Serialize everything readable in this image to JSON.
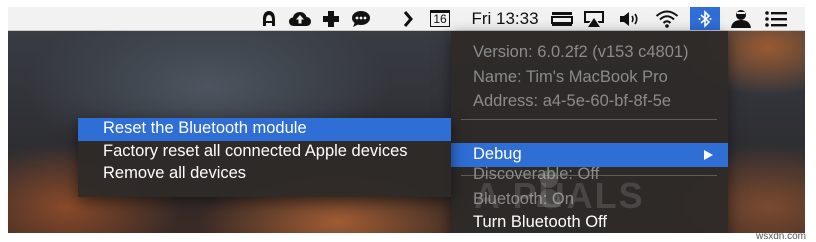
{
  "menubar": {
    "clock": "Fri 13:33",
    "calendar_day": "16",
    "status_icons": [
      "alfred-hat-icon",
      "cloud-upload-icon",
      "medical-cross-icon",
      "chat-bubble-icon",
      "chevron-right-icon",
      "calendar-icon",
      "screen-mirror-icon",
      "airplay-icon",
      "volume-icon",
      "wifi-icon",
      "bluetooth-icon",
      "user-silhouette-icon",
      "list-menu-icon"
    ]
  },
  "bluetooth_menu": {
    "version": "Version: 6.0.2f2 (v153 c4801)",
    "name": "Name: Tim's MacBook Pro",
    "address": "Address: a4-5e-60-bf-8f-5e",
    "debug": "Debug",
    "discoverable": "Discoverable: Off",
    "bluetooth_state": "Bluetooth: On",
    "turn_off": "Turn Bluetooth Off"
  },
  "debug_submenu": {
    "items": [
      "Reset the Bluetooth module",
      "Factory reset all connected Apple devices",
      "Remove all devices"
    ],
    "selected_index": 0
  },
  "watermark": {
    "logo_text": "A  PUALS"
  },
  "credit": "wsxdn.com",
  "colors": {
    "highlight": "#2e6ed5",
    "menu_bg": "#2d2a28",
    "disabled_text": "#8b8b8b",
    "menubar_bg": "#f2f2f2"
  }
}
